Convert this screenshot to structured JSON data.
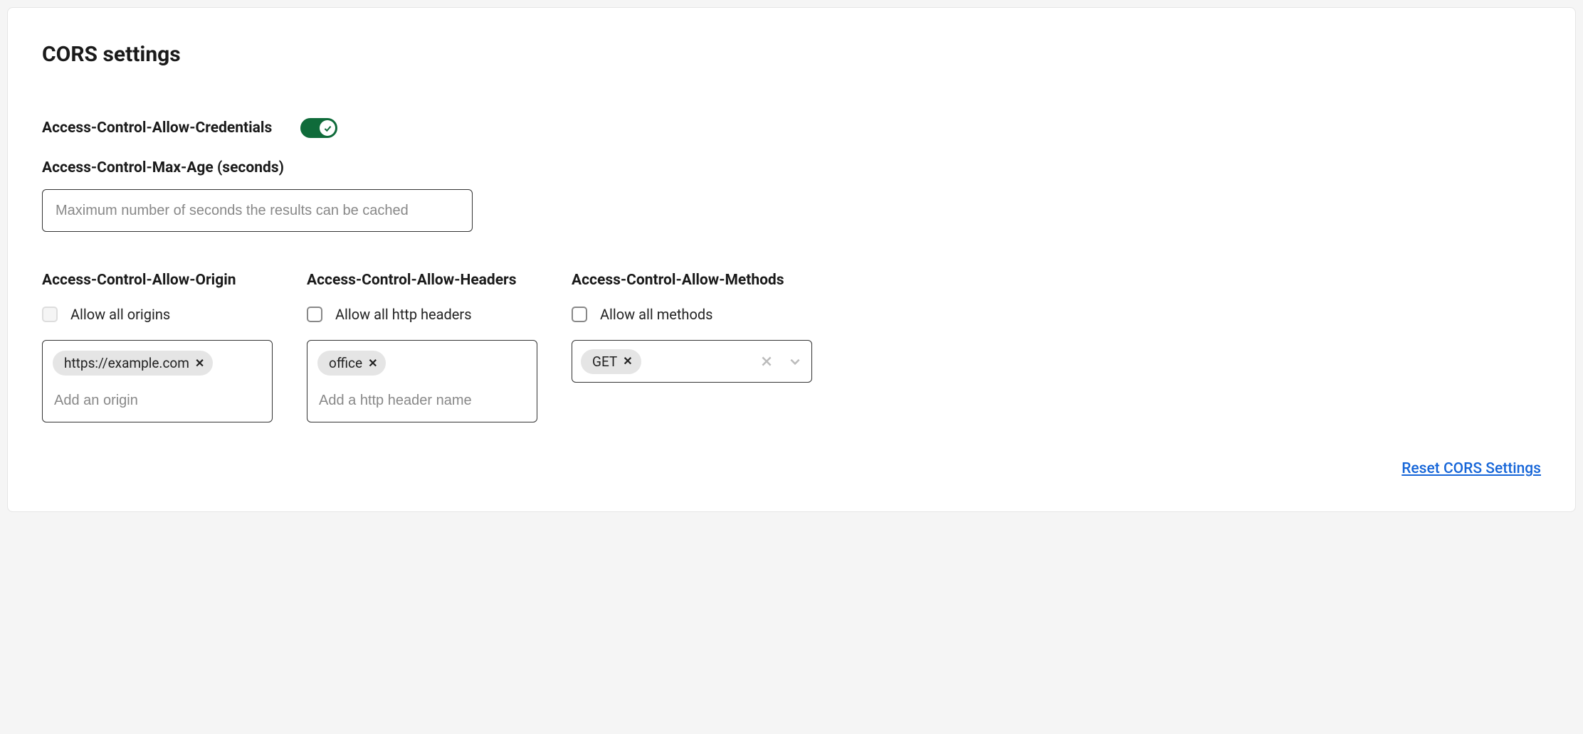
{
  "title": "CORS settings",
  "credentials": {
    "label": "Access-Control-Allow-Credentials",
    "enabled": true
  },
  "maxAge": {
    "label": "Access-Control-Max-Age (seconds)",
    "placeholder": "Maximum number of seconds the results can be cached",
    "value": ""
  },
  "origin": {
    "label": "Access-Control-Allow-Origin",
    "allowAllLabel": "Allow all origins",
    "allowAllChecked": false,
    "allowAllDisabled": true,
    "tags": [
      "https://example.com"
    ],
    "placeholder": "Add an origin"
  },
  "headers": {
    "label": "Access-Control-Allow-Headers",
    "allowAllLabel": "Allow all http headers",
    "allowAllChecked": false,
    "allowAllDisabled": false,
    "tags": [
      "office"
    ],
    "placeholder": "Add a http header name"
  },
  "methods": {
    "label": "Access-Control-Allow-Methods",
    "allowAllLabel": "Allow all methods",
    "allowAllChecked": false,
    "allowAllDisabled": false,
    "tags": [
      "GET"
    ]
  },
  "resetLabel": "Reset CORS Settings"
}
